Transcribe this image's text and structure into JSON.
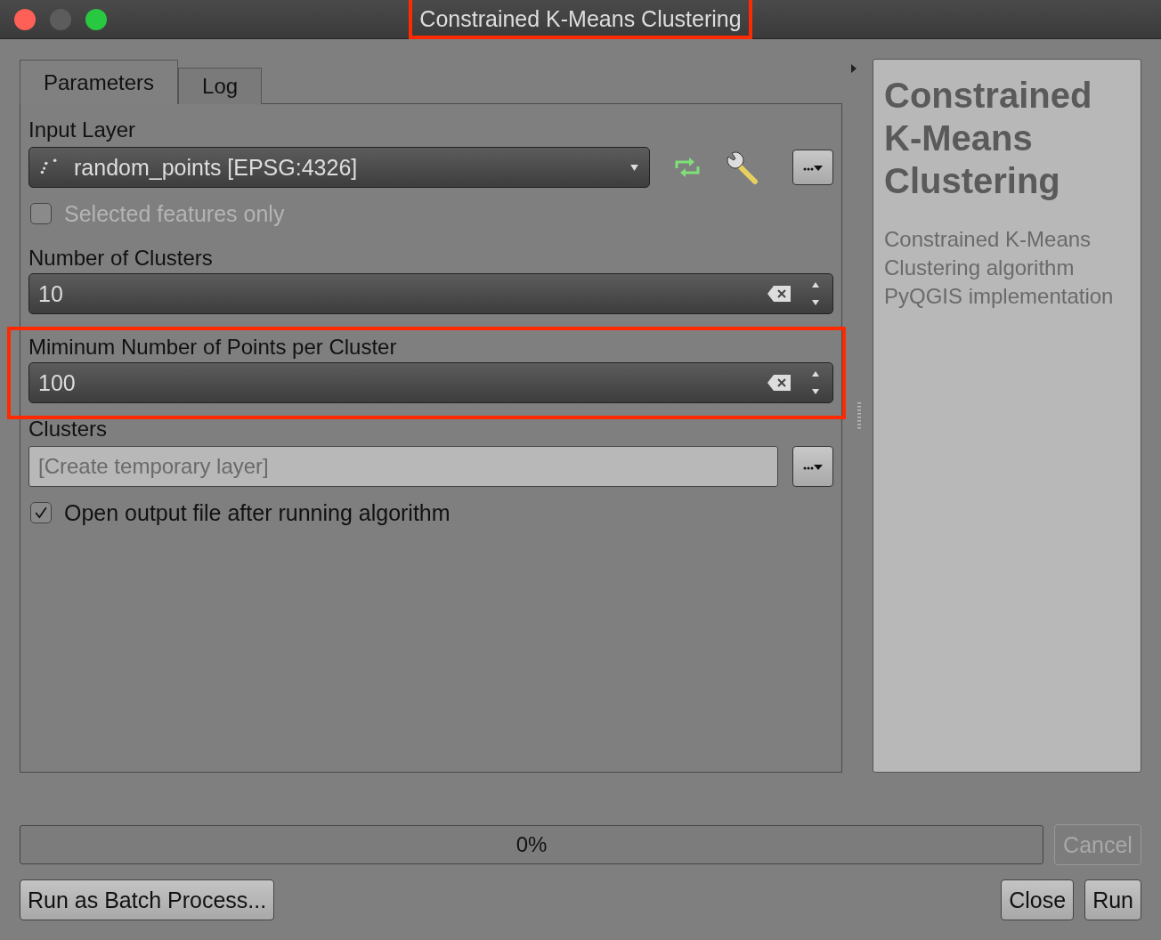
{
  "window": {
    "title": "Constrained K-Means Clustering",
    "highlighted": true
  },
  "tabs": [
    {
      "label": "Parameters",
      "selected": true
    },
    {
      "label": "Log",
      "selected": false
    }
  ],
  "parameters": [
    {
      "kind": "layer",
      "label": "Input Layer",
      "value": "random_points [EPSG:4326]"
    },
    {
      "kind": "checkbox",
      "label": "Selected features only",
      "checked": false,
      "disabled": true
    },
    {
      "kind": "number",
      "label": "Number of Clusters",
      "value": "10"
    },
    {
      "kind": "number",
      "label": "Miminum Number of Points per Cluster",
      "value": "100",
      "highlighted": true
    },
    {
      "kind": "sink",
      "label": "Clusters",
      "placeholder": "[Create temporary layer]"
    },
    {
      "kind": "checkbox",
      "label": "Open output file after running algorithm",
      "checked": true,
      "disabled": false
    }
  ],
  "help": {
    "title": "Constrained K-Means Clustering",
    "description": "Constrained K-Means Clustering algorithm PyQGIS implementation"
  },
  "progress": {
    "level": 0,
    "reading": "0%"
  },
  "cancel_button": {
    "label": "Cancel",
    "disabled": true
  },
  "buttons": [
    {
      "label": "Run as Batch Process...",
      "kind": "left"
    },
    {
      "label": "Close",
      "kind": "right"
    },
    {
      "label": "Run",
      "kind": "right"
    }
  ]
}
